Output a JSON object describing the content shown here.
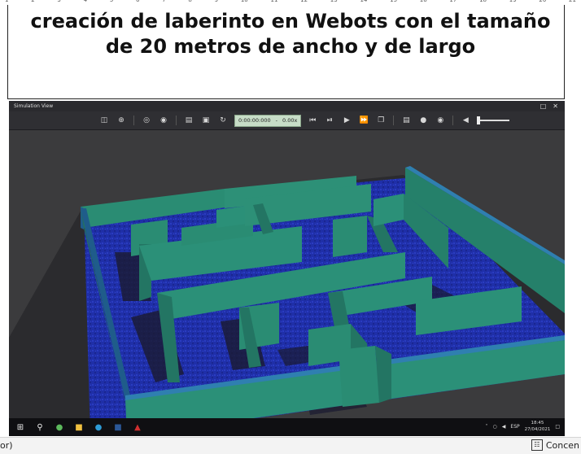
{
  "ruler": {
    "numbers": [
      "1",
      "2",
      "3",
      "4",
      "5",
      "6",
      "7",
      "8",
      "9",
      "10",
      "11",
      "12",
      "13",
      "14",
      "15",
      "16",
      "17",
      "18",
      "19",
      "20",
      "21"
    ]
  },
  "document": {
    "title_line1": "creación de laberinto en Webots con el tamaño",
    "title_line2": "de 20 metros de ancho y de largo"
  },
  "sim_window": {
    "title": "Simulation View",
    "time": "0:00:00:000",
    "separator": "-",
    "speed": "0.00x",
    "colors": {
      "floor": "#1f2fa8",
      "wall": "#2c8f78",
      "background": "#3a3a3c"
    }
  },
  "taskbar": {
    "language": "ESP",
    "time": "18:45",
    "date": "27/04/2021"
  },
  "statusbar": {
    "left_text": "or)",
    "right_text": "Concen"
  }
}
